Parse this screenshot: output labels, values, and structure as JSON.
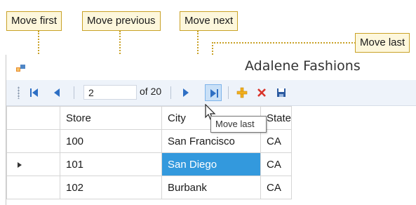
{
  "callouts": {
    "move_first": "Move first",
    "move_previous": "Move previous",
    "move_next": "Move next",
    "move_last": "Move last"
  },
  "window": {
    "title": "Adalene Fashions",
    "icon": "form-icon"
  },
  "navigator": {
    "position": "2",
    "count_label": "of 20",
    "buttons": [
      "move-first-icon",
      "move-previous-icon",
      "move-next-icon",
      "move-last-icon",
      "add-new-icon",
      "delete-icon",
      "save-icon"
    ],
    "tooltip": "Move last"
  },
  "grid": {
    "columns": [
      "Store",
      "City",
      "State"
    ],
    "rows": [
      {
        "store": "100",
        "city": "San Francisco",
        "state": "CA"
      },
      {
        "store": "101",
        "city": "San Diego",
        "state": "CA"
      },
      {
        "store": "102",
        "city": "Burbank",
        "state": "CA"
      }
    ],
    "current_row_indicator": "row-pointer-icon"
  },
  "colors": {
    "callout_bg": "#fdf7dc",
    "callout_border": "#c9a227",
    "selection": "#3399dd",
    "toolbar_bg": "#eef3fa"
  }
}
